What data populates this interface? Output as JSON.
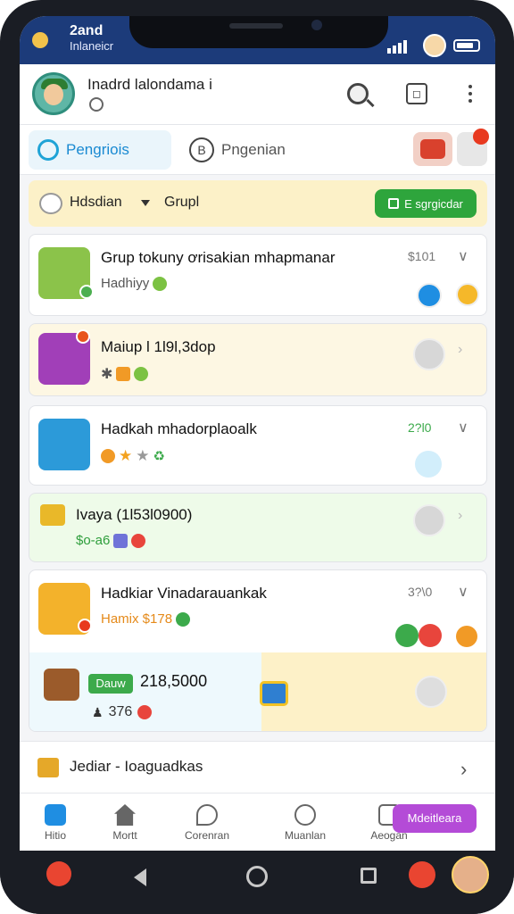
{
  "status": {
    "time": "2and",
    "sub": "Inlaneicr"
  },
  "header": {
    "name": "Inadrd lalondama i"
  },
  "tabs": [
    {
      "label": "Pengriois",
      "active": true
    },
    {
      "label": "Pngenian",
      "active": false
    }
  ],
  "filter": {
    "label": "Hdsdian",
    "group": "Grupl",
    "action_label": "E sgrgicdar"
  },
  "cards": [
    {
      "title": "Grup tokuny ơrisakian mhapmanar",
      "sub": "Hadhiyy",
      "meta": "$101"
    },
    {
      "title": "Maiup l 1l9l,3dop",
      "sub": "",
      "meta": ""
    },
    {
      "title": "Hadkah mhadorplaoalk",
      "sub": "",
      "meta": "2?l0"
    },
    {
      "title": "Ivaya (1l53l0900)",
      "sub": "$o-a6",
      "meta": ""
    },
    {
      "title": "Hadkiar Vinadarauankak",
      "sub": "Hamix $178",
      "meta": "3?\\0"
    }
  ],
  "embedded": {
    "badge": "Dauw",
    "amount": "218,5000",
    "count": "376"
  },
  "link_row": {
    "label": "Jediar - Ioaguadkas"
  },
  "nav": [
    {
      "label": "Hitio"
    },
    {
      "label": "Mortt"
    },
    {
      "label": "Corenran"
    },
    {
      "label": "Muanlan"
    },
    {
      "label": "Aeogan"
    }
  ],
  "cta": {
    "label": "Mdeitleara"
  },
  "colors": {
    "status_bar": "#1c3b7a",
    "accent_blue": "#1a8ad2",
    "accent_green": "#2ea53c",
    "accent_purple": "#b44bd7",
    "filter_bg": "#fcf1c8"
  }
}
